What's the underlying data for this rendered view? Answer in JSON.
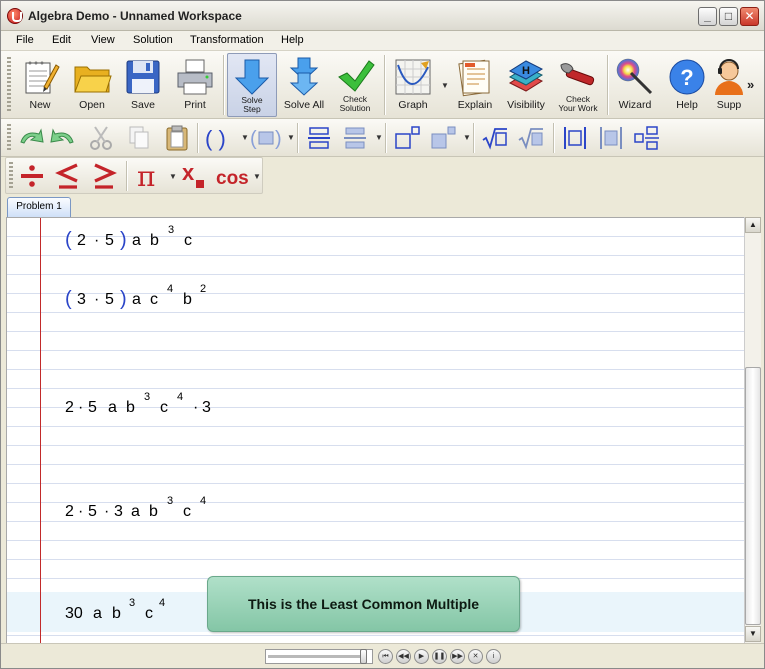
{
  "window": {
    "title": "Algebra Demo - Unnamed Workspace"
  },
  "menu": [
    "File",
    "Edit",
    "View",
    "Solution",
    "Transformation",
    "Help"
  ],
  "toolbar": {
    "buttons": [
      {
        "id": "new",
        "label": "New",
        "icon": "notepad-pencil-icon"
      },
      {
        "id": "open",
        "label": "Open",
        "icon": "folder-icon"
      },
      {
        "id": "save",
        "label": "Save",
        "icon": "floppy-disk-icon"
      },
      {
        "id": "print",
        "label": "Print",
        "icon": "printer-icon"
      },
      {
        "id": "solve_step",
        "label_line1": "Solve",
        "label_line2": "Step",
        "icon": "down-arrow-icon",
        "state": "pressed"
      },
      {
        "id": "solve_all",
        "label": "Solve All",
        "icon": "double-down-arrow-icon"
      },
      {
        "id": "check_solution",
        "label_line1": "Check",
        "label_line2": "Solution",
        "icon": "check-mark-icon"
      },
      {
        "id": "graph",
        "label": "Graph",
        "icon": "graph-icon"
      },
      {
        "id": "explain",
        "label": "Explain",
        "icon": "document-icon"
      },
      {
        "id": "visibility",
        "label": "Visibility",
        "icon": "layers-icon"
      },
      {
        "id": "check_work",
        "label_line1": "Check",
        "label_line2": "Your Work",
        "icon": "wrench-icon"
      },
      {
        "id": "wizard",
        "label": "Wizard",
        "icon": "magic-wand-icon"
      },
      {
        "id": "help",
        "label": "Help",
        "icon": "help-circle-icon"
      },
      {
        "id": "support",
        "label": "Supp",
        "icon": "support-person-icon"
      }
    ],
    "overflow": "»"
  },
  "tabs": [
    {
      "label": "Problem 1",
      "active": true
    }
  ],
  "workspace": {
    "line1": {
      "lp": "(",
      "a": "2",
      "dot": "·",
      "b": "5",
      "rp": ")",
      "v1": "a",
      "v2": "b",
      "e2": "3",
      "v3": "c"
    },
    "line2": {
      "lp": "(",
      "a": "3",
      "dot": "·",
      "b": "5",
      "rp": ")",
      "v1": "a",
      "v2": "c",
      "e2": "4",
      "v3": "b",
      "e3": "2"
    },
    "line3": {
      "a": "2",
      "d1": "·",
      "b": "5",
      "v1": "a",
      "v2": "b",
      "e2": "3",
      "v3": "c",
      "e3": "4",
      "d2": "·",
      "c": "3"
    },
    "line4": {
      "a": "2",
      "d1": "·",
      "b": "5",
      "d2": "·",
      "c": "3",
      "v1": "a",
      "v2": "b",
      "e2": "3",
      "v3": "c",
      "e3": "4"
    },
    "line5": {
      "coef": "30",
      "v1": "a",
      "v2": "b",
      "e2": "3",
      "v3": "c",
      "e3": "4"
    },
    "callout": "This is the Least Common Multiple"
  },
  "colors": {
    "accent_blue": "#2b45c8",
    "margin_red": "#c22a2a",
    "callout_green": "#9bd4b8"
  }
}
